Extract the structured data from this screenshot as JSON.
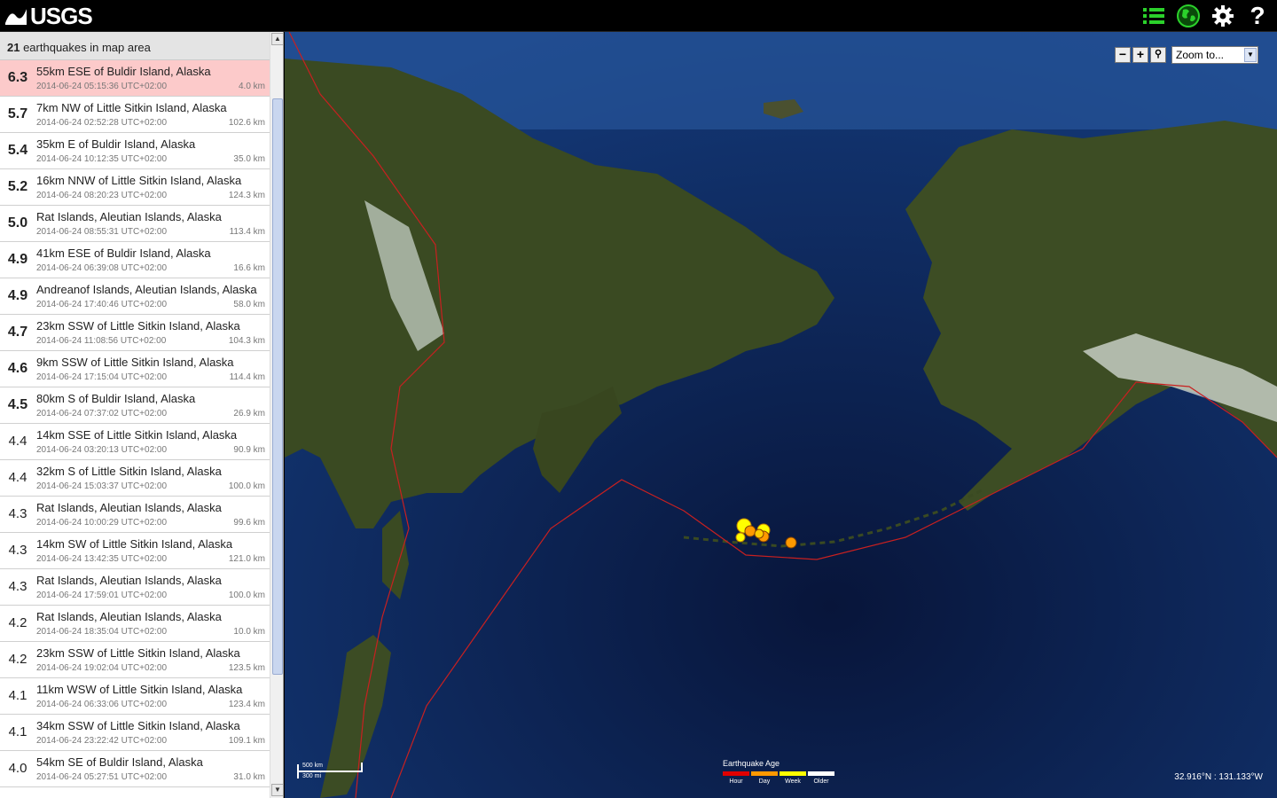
{
  "header": {
    "logo_text": "USGS",
    "icons": [
      "list-icon",
      "globe-icon",
      "gear-icon",
      "help-icon"
    ]
  },
  "sidebar": {
    "count_number": "21",
    "count_suffix": " earthquakes in map area",
    "earthquakes": [
      {
        "mag": "6.3",
        "place": "55km ESE of Buldir Island, Alaska",
        "time": "2014-06-24 05:15:36 UTC+02:00",
        "depth": "4.0 km",
        "selected": true
      },
      {
        "mag": "5.7",
        "place": "7km NW of Little Sitkin Island, Alaska",
        "time": "2014-06-24 02:52:28 UTC+02:00",
        "depth": "102.6 km"
      },
      {
        "mag": "5.4",
        "place": "35km E of Buldir Island, Alaska",
        "time": "2014-06-24 10:12:35 UTC+02:00",
        "depth": "35.0 km"
      },
      {
        "mag": "5.2",
        "place": "16km NNW of Little Sitkin Island, Alaska",
        "time": "2014-06-24 08:20:23 UTC+02:00",
        "depth": "124.3 km"
      },
      {
        "mag": "5.0",
        "place": "Rat Islands, Aleutian Islands, Alaska",
        "time": "2014-06-24 08:55:31 UTC+02:00",
        "depth": "113.4 km"
      },
      {
        "mag": "4.9",
        "place": "41km ESE of Buldir Island, Alaska",
        "time": "2014-06-24 06:39:08 UTC+02:00",
        "depth": "16.6 km"
      },
      {
        "mag": "4.9",
        "place": "Andreanof Islands, Aleutian Islands, Alaska",
        "time": "2014-06-24 17:40:46 UTC+02:00",
        "depth": "58.0 km"
      },
      {
        "mag": "4.7",
        "place": "23km SSW of Little Sitkin Island, Alaska",
        "time": "2014-06-24 11:08:56 UTC+02:00",
        "depth": "104.3 km"
      },
      {
        "mag": "4.6",
        "place": "9km SSW of Little Sitkin Island, Alaska",
        "time": "2014-06-24 17:15:04 UTC+02:00",
        "depth": "114.4 km"
      },
      {
        "mag": "4.5",
        "place": "80km S of Buldir Island, Alaska",
        "time": "2014-06-24 07:37:02 UTC+02:00",
        "depth": "26.9 km"
      },
      {
        "mag": "4.4",
        "place": "14km SSE of Little Sitkin Island, Alaska",
        "time": "2014-06-24 03:20:13 UTC+02:00",
        "depth": "90.9 km"
      },
      {
        "mag": "4.4",
        "place": "32km S of Little Sitkin Island, Alaska",
        "time": "2014-06-24 15:03:37 UTC+02:00",
        "depth": "100.0 km"
      },
      {
        "mag": "4.3",
        "place": "Rat Islands, Aleutian Islands, Alaska",
        "time": "2014-06-24 10:00:29 UTC+02:00",
        "depth": "99.6 km"
      },
      {
        "mag": "4.3",
        "place": "14km SW of Little Sitkin Island, Alaska",
        "time": "2014-06-24 13:42:35 UTC+02:00",
        "depth": "121.0 km"
      },
      {
        "mag": "4.3",
        "place": "Rat Islands, Aleutian Islands, Alaska",
        "time": "2014-06-24 17:59:01 UTC+02:00",
        "depth": "100.0 km"
      },
      {
        "mag": "4.2",
        "place": "Rat Islands, Aleutian Islands, Alaska",
        "time": "2014-06-24 18:35:04 UTC+02:00",
        "depth": "10.0 km"
      },
      {
        "mag": "4.2",
        "place": "23km SSW of Little Sitkin Island, Alaska",
        "time": "2014-06-24 19:02:04 UTC+02:00",
        "depth": "123.5 km"
      },
      {
        "mag": "4.1",
        "place": "11km WSW of Little Sitkin Island, Alaska",
        "time": "2014-06-24 06:33:06 UTC+02:00",
        "depth": "123.4 km"
      },
      {
        "mag": "4.1",
        "place": "34km SSW of Little Sitkin Island, Alaska",
        "time": "2014-06-24 23:22:42 UTC+02:00",
        "depth": "109.1 km"
      },
      {
        "mag": "4.0",
        "place": "54km SE of Buldir Island, Alaska",
        "time": "2014-06-24 05:27:51 UTC+02:00",
        "depth": "31.0 km"
      }
    ]
  },
  "map": {
    "zoom_placeholder": "Zoom to...",
    "scale_km": "500 km",
    "scale_mi": "300 mi",
    "legend_title": "Earthquake Age",
    "legend": [
      {
        "label": "Hour",
        "color": "#e00000"
      },
      {
        "label": "Day",
        "color": "#ff9900"
      },
      {
        "label": "Week",
        "color": "#ffff00"
      },
      {
        "label": "Older",
        "color": "#ffffff"
      }
    ],
    "coordinates": "32.916°N : 131.133°W"
  }
}
